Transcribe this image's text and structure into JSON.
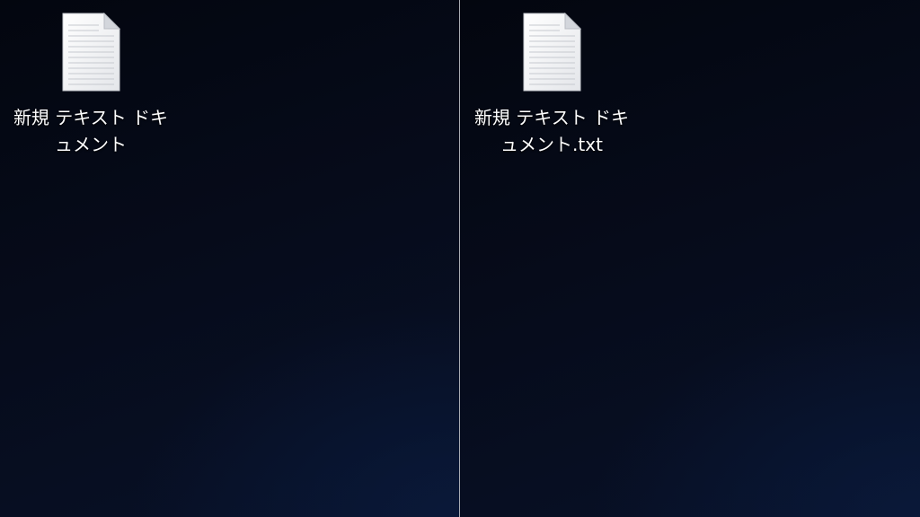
{
  "desktop_left": {
    "icon": {
      "type": "document-icon",
      "label": "新規 テキスト ドキュメント"
    }
  },
  "desktop_right": {
    "icon": {
      "type": "text-document-icon",
      "label": "新規 テキスト ドキュメント.txt"
    }
  },
  "colors": {
    "background": "#050a17",
    "divider": "#a9acb3",
    "label_text": "#ffffff"
  }
}
